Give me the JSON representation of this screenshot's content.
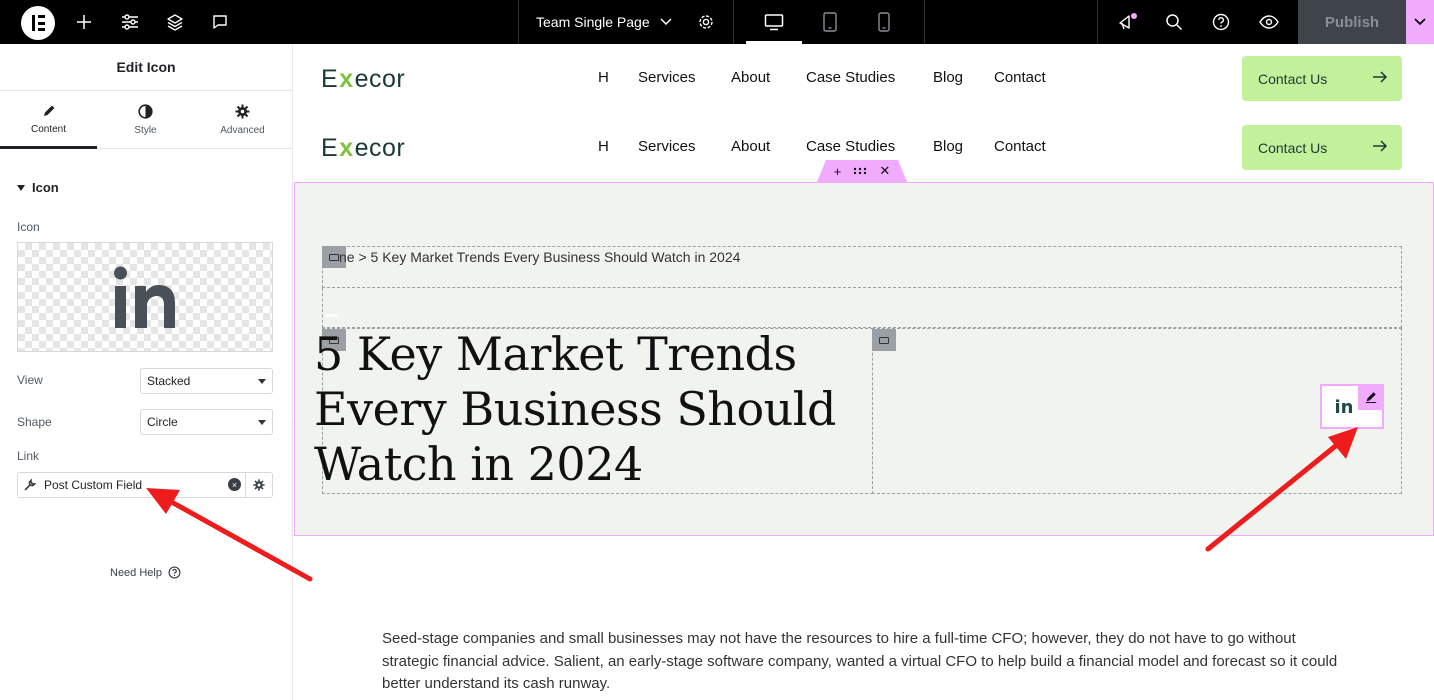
{
  "topbar": {
    "page_title": "Team Single Page",
    "publish_label": "Publish"
  },
  "panel": {
    "title": "Edit Icon",
    "tabs": [
      {
        "label": "Content",
        "icon": "pencil-icon",
        "active": true
      },
      {
        "label": "Style",
        "icon": "half-circle-icon",
        "active": false
      },
      {
        "label": "Advanced",
        "icon": "gear-icon",
        "active": false
      }
    ],
    "section_title": "Icon",
    "icon_label": "Icon",
    "preview_icon": "linkedin-icon",
    "view_label": "View",
    "view_value": "Stacked",
    "shape_label": "Shape",
    "shape_value": "Circle",
    "link_label": "Link",
    "link_value": "Post Custom Field",
    "need_help": "Need Help"
  },
  "canvas": {
    "brand": {
      "pre": "E",
      "x": "x",
      "post": "ecor"
    },
    "nav": [
      "H",
      "Services",
      "About",
      "Case Studies",
      "Blog",
      "Contact"
    ],
    "cta_label": "Contact Us",
    "breadcrumb": "ne  >  5 Key Market Trends Every Business Should Watch in 2024",
    "hero_title": "5 Key Market Trends Every Business Should Watch in 2024",
    "social_icon_text": "in",
    "body_text": "Seed-stage companies and small businesses may not have the resources to hire a full-time CFO; however, they do not have to go without strategic financial advice. Salient, an early-stage software company, wanted a virtual CFO to help build a financial model and forecast so it could better understand its cash runway."
  },
  "colors": {
    "accent": "#f0abfc",
    "cta_bg": "#c3f09a",
    "section_bg": "#f1f3ef",
    "annotation_arrow": "#ee1c1c"
  }
}
